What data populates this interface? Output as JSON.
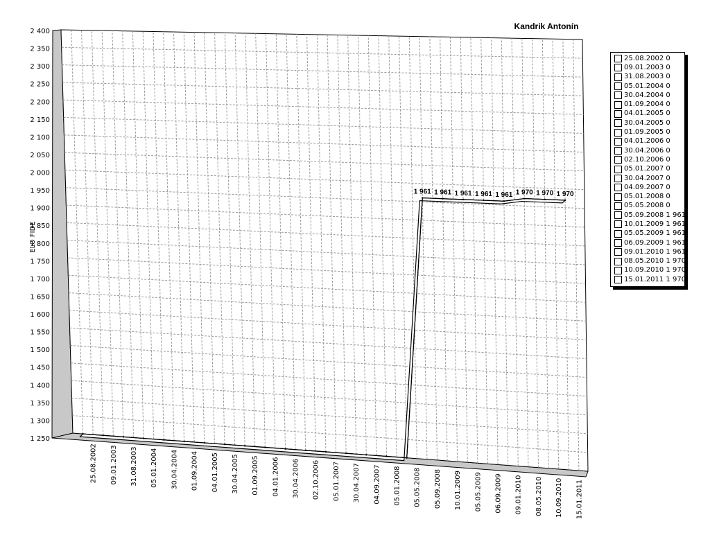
{
  "chart_data": {
    "type": "line",
    "title": "Kandrik Antonín",
    "ylabel": "ELO FIDE",
    "xlabel": "",
    "ylim": [
      1250,
      2400
    ],
    "yticks": [
      "2 400",
      "2 350",
      "2 300",
      "2 250",
      "2 200",
      "2 150",
      "2 100",
      "2 050",
      "2 000",
      "1 950",
      "1 900",
      "1 850",
      "1 800",
      "1 750",
      "1 700",
      "1 650",
      "1 600",
      "1 550",
      "1 500",
      "1 450",
      "1 400",
      "1 350",
      "1 300",
      "1 250"
    ],
    "categories": [
      "25.08.2002",
      "09.01.2003",
      "31.08.2003",
      "05.01.2004",
      "30.04.2004",
      "01.09.2004",
      "04.01.2005",
      "30.04.2005",
      "01.09.2005",
      "04.01.2006",
      "30.04.2006",
      "02.10.2006",
      "05.01.2007",
      "30.04.2007",
      "04.09.2007",
      "05.01.2008",
      "05.05.2008",
      "05.09.2008",
      "10.01.2009",
      "05.05.2009",
      "06.09.2009",
      "09.01.2010",
      "08.05.2010",
      "10.09.2010",
      "15.01.2011"
    ],
    "values": [
      0,
      0,
      0,
      0,
      0,
      0,
      0,
      0,
      0,
      0,
      0,
      0,
      0,
      0,
      0,
      0,
      0,
      1961,
      1961,
      1961,
      1961,
      1961,
      1970,
      1970,
      1970
    ],
    "data_labels": [
      "",
      "",
      "",
      "",
      "",
      "",
      "",
      "",
      "",
      "",
      "",
      "",
      "",
      "",
      "",
      "",
      "",
      "1 961",
      "1 961",
      "1 961",
      "1 961",
      "1 961",
      "1 970",
      "1 970",
      "1 970"
    ],
    "grid": true,
    "legend_position": "right",
    "legend": [
      "25.08.2002 0",
      "09.01.2003 0",
      "31.08.2003 0",
      "05.01.2004 0",
      "30.04.2004 0",
      "01.09.2004 0",
      "04.01.2005 0",
      "30.04.2005 0",
      "01.09.2005 0",
      "04.01.2006 0",
      "30.04.2006 0",
      "02.10.2006 0",
      "05.01.2007 0",
      "30.04.2007 0",
      "04.09.2007 0",
      "05.01.2008 0",
      "05.05.2008 0",
      "05.09.2008 1 961",
      "10.01.2009 1 961",
      "05.05.2009 1 961",
      "06.09.2009 1 961",
      "09.01.2010 1 961",
      "08.05.2010 1 970",
      "10.09.2010 1 970",
      "15.01.2011 1 970"
    ],
    "colors": {
      "line_fill": "#ffffff",
      "line_stroke": "#000000",
      "wall": "#c8c8c8",
      "grid": "#9a9a9a"
    }
  }
}
